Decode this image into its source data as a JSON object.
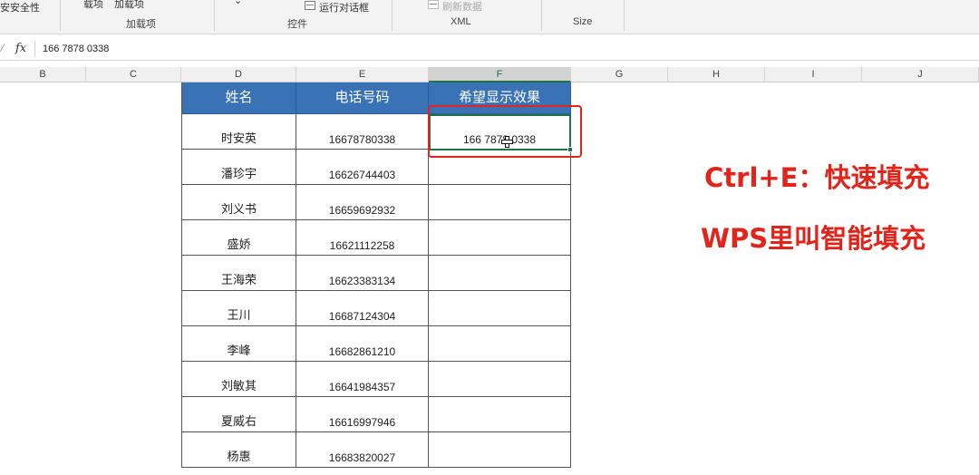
{
  "ribbon": {
    "security_label": "安安全性",
    "addins_item1": "载项",
    "addins_item2": "加载项",
    "addins_group": "加载项",
    "run_dialog_label": "运行对话框",
    "controls_group": "控件",
    "refresh_data_label": "刷新数据",
    "xml_group": "XML",
    "size_group": "Size"
  },
  "formula_bar": {
    "fx_label": "fx",
    "value": "166 7878 0338"
  },
  "columns": [
    "B",
    "C",
    "D",
    "E",
    "F",
    "G",
    "H",
    "I",
    "J"
  ],
  "selected_column": "F",
  "table": {
    "headers": [
      "姓名",
      "电话号码",
      "希望显示效果"
    ],
    "rows": [
      {
        "name": "时安英",
        "phone": "16678780338",
        "formatted": "166 7878 0338"
      },
      {
        "name": "潘珍宇",
        "phone": "16626744403",
        "formatted": ""
      },
      {
        "name": "刘义书",
        "phone": "16659692932",
        "formatted": ""
      },
      {
        "name": "盛娇",
        "phone": "16621112258",
        "formatted": ""
      },
      {
        "name": "王海荣",
        "phone": "16623383134",
        "formatted": ""
      },
      {
        "name": "王川",
        "phone": "16687124304",
        "formatted": ""
      },
      {
        "name": "李峰",
        "phone": "16682861210",
        "formatted": ""
      },
      {
        "name": "刘敏其",
        "phone": "16641984357",
        "formatted": ""
      },
      {
        "name": "夏威右",
        "phone": "16616997946",
        "formatted": ""
      },
      {
        "name": "杨惠",
        "phone": "16683820027",
        "formatted": ""
      }
    ]
  },
  "notes": {
    "line1": "Ctrl+E：快速填充",
    "line2": "WPS里叫智能填充"
  },
  "colors": {
    "header_blue": "#3a73b5",
    "selection_green": "#217346",
    "annotation_red": "#e3241b"
  }
}
